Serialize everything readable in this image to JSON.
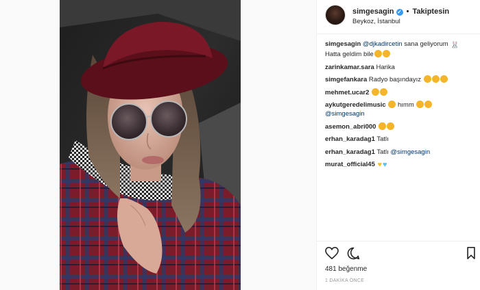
{
  "header": {
    "username": "simgesagin",
    "separator": "•",
    "follow_label": "Takiptesin",
    "location": "Beykoz, İstanbul"
  },
  "caption": {
    "username": "simgesagin",
    "mention": "@djkadircetin",
    "text1": " sana geliyorum ",
    "text2": "Hatta geldim bile"
  },
  "comments": [
    {
      "username": "zarinkamar.sara",
      "text": "Harika"
    },
    {
      "username": "simgefankara",
      "text": "Radyo başındayız"
    },
    {
      "username": "mehmet.ucar2",
      "text": ""
    },
    {
      "username": "aykutgeredelimusic",
      "text": " hımm",
      "mention": "@simgesagin"
    },
    {
      "username": "asemon_abri000",
      "text": ""
    },
    {
      "username": "erhan_karadag1",
      "text": "Tatlı"
    },
    {
      "username": "erhan_karadag1",
      "text": "Tatlı ",
      "mention": "@simgesagin"
    },
    {
      "username": "murat_official45",
      "text": ""
    }
  ],
  "footer": {
    "likes": "481 beğenme",
    "time": "1 DAKİKA ÖNCE"
  },
  "icons": {
    "verified": "verified-badge-icon",
    "like": "heart-outline-icon",
    "comment": "comment-bubble-icon",
    "save": "bookmark-outline-icon"
  },
  "colors": {
    "mention": "#003569",
    "verified": "#3897f0",
    "meta": "#999999"
  }
}
